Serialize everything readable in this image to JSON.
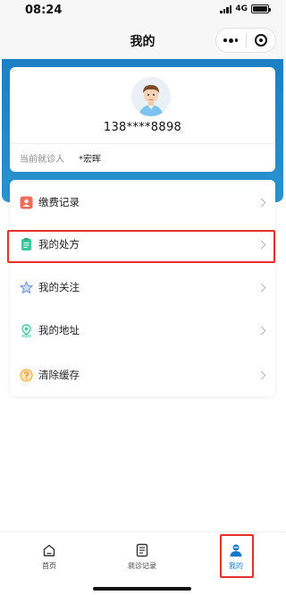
{
  "status_bar": {
    "time": "08:24",
    "network": "4G",
    "battery_level": 1.0
  },
  "nav": {
    "title": "我的",
    "more_icon": "more-dots-icon",
    "close_icon": "target-circle-icon"
  },
  "profile": {
    "phone": "138****8898",
    "patient_label": "当前就诊人",
    "patient_name": "*宏晖"
  },
  "menu": {
    "items": [
      {
        "label": "缴费记录",
        "icon": "payment-record-icon",
        "color": "#f26b5b"
      },
      {
        "label": "我的处方",
        "icon": "prescription-icon",
        "color": "#3cc59a"
      },
      {
        "label": "我的关注",
        "icon": "star-icon",
        "color": "#6a8fd8"
      },
      {
        "label": "我的地址",
        "icon": "location-pin-icon",
        "color": "#3cc59a"
      },
      {
        "label": "清除缓存",
        "icon": "question-circle-icon",
        "color": "#f5a524"
      }
    ]
  },
  "tabs": {
    "items": [
      {
        "label": "首页",
        "icon": "home-icon"
      },
      {
        "label": "就诊记录",
        "icon": "document-icon"
      },
      {
        "label": "我的",
        "icon": "person-icon",
        "active": true
      }
    ]
  },
  "colors": {
    "brand_blue": "#1c7fc3",
    "active_tab": "#1677c8",
    "annotation_red": "#e8302a"
  }
}
